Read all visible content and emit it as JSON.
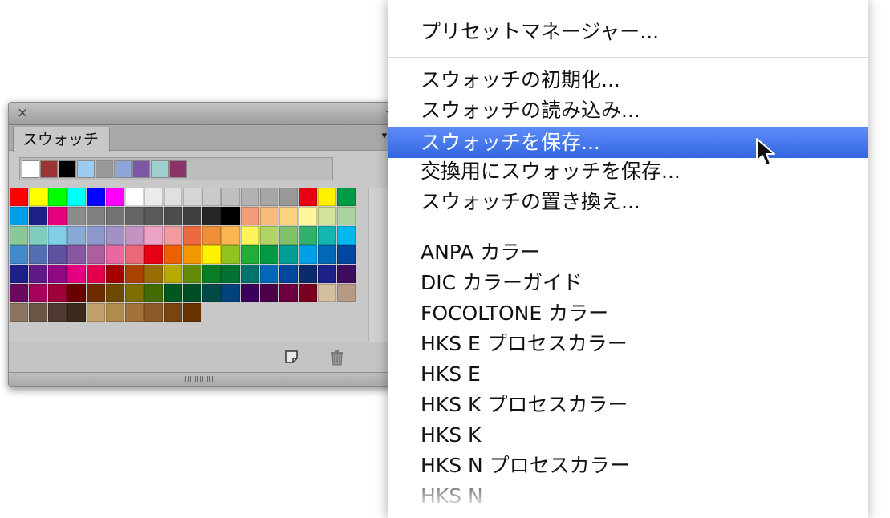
{
  "panel": {
    "close_glyph": "×",
    "collapse_glyph": "◀◀",
    "tab_label": "スウォッチ",
    "menu_glyph": "≡",
    "recent_swatches": [
      "#ffffff",
      "#9b3535",
      "#000000",
      "#9ccdf0",
      "#999999",
      "#8fa5d8",
      "#7d57a6",
      "#9fcfcf",
      "#8a3368"
    ],
    "swatches": [
      "#ff0000",
      "#ffff00",
      "#00ff00",
      "#00ffff",
      "#0000ff",
      "#ff00ff",
      "#ffffff",
      "#ebebeb",
      "#e0e0e0",
      "#d6d6d6",
      "#cacaca",
      "#bfbfbf",
      "#b2b2b2",
      "#a6a6a6",
      "#999999",
      "#e60012",
      "#fff100",
      "#009944",
      "#00a0e9",
      "#1d2088",
      "#e4007f",
      "#8c8c8c",
      "#808080",
      "#737373",
      "#666666",
      "#595959",
      "#4d4d4d",
      "#404040",
      "#262626",
      "#000000",
      "#f19d76",
      "#f7b97d",
      "#fdd27f",
      "#fff59b",
      "#d2e29a",
      "#a9d49e",
      "#89c997",
      "#7ecdbf",
      "#7fcfe6",
      "#89a9d7",
      "#8c98cc",
      "#a291c7",
      "#c593c2",
      "#eea3c5",
      "#f19a9f",
      "#ec6941",
      "#f08f38",
      "#f8b551",
      "#fff45c",
      "#b3d465",
      "#80c269",
      "#32b16c",
      "#13b5b1",
      "#00b7ee",
      "#448aca",
      "#556fb5",
      "#5f52a0",
      "#8957a1",
      "#ae5da1",
      "#ea68a2",
      "#eb6877",
      "#e60012",
      "#eb6100",
      "#f39800",
      "#fff100",
      "#8fc31f",
      "#22ac38",
      "#009944",
      "#009e96",
      "#00a0e9",
      "#0068b7",
      "#00479d",
      "#1d2088",
      "#601986",
      "#920783",
      "#e4007f",
      "#e5004f",
      "#a40000",
      "#a84200",
      "#996c00",
      "#b7aa00",
      "#638c0b",
      "#097c25",
      "#007130",
      "#00736d",
      "#0068b7",
      "#00479d",
      "#0a2c6d",
      "#1d2088",
      "#3f0b5f",
      "#6a0a5e",
      "#a5005b",
      "#9e0039",
      "#6a0000",
      "#6f2b00",
      "#6e4a00",
      "#7d6f00",
      "#426b00",
      "#00581f",
      "#004e26",
      "#004b47",
      "#00427c",
      "#3b005b",
      "#4b0049",
      "#6c0040",
      "#7a0022",
      "#d4bfa0",
      "#b69a83",
      "#8b7460",
      "#6b5545",
      "#4e3a30",
      "#3a2a1e",
      "#c5a06b",
      "#b38a4e",
      "#a07138",
      "#8c5a24",
      "#784412",
      "#663300"
    ]
  },
  "menu": {
    "items": [
      {
        "label": "プリセットマネージャー...",
        "state": "normal"
      },
      {
        "label": "スウォッチの初期化...",
        "state": "normal"
      },
      {
        "label": "スウォッチの読み込み...",
        "state": "normal"
      },
      {
        "label": "スウォッチを保存...",
        "state": "selected"
      },
      {
        "label": "交換用にスウォッチを保存...",
        "state": "normal"
      },
      {
        "label": "スウォッチの置き換え...",
        "state": "normal"
      },
      {
        "label": "ANPA カラー",
        "state": "normal"
      },
      {
        "label": "DIC カラーガイド",
        "state": "normal"
      },
      {
        "label": "FOCOLTONE カラー",
        "state": "normal"
      },
      {
        "label": "HKS E プロセスカラー",
        "state": "normal"
      },
      {
        "label": "HKS E",
        "state": "normal"
      },
      {
        "label": "HKS K プロセスカラー",
        "state": "normal"
      },
      {
        "label": "HKS K",
        "state": "normal"
      },
      {
        "label": "HKS N プロセスカラー",
        "state": "normal"
      },
      {
        "label": "HKS N",
        "state": "normal"
      }
    ]
  },
  "colors": {
    "selection": "#3c6fe8",
    "panel_bg": "#c8c8c8"
  }
}
